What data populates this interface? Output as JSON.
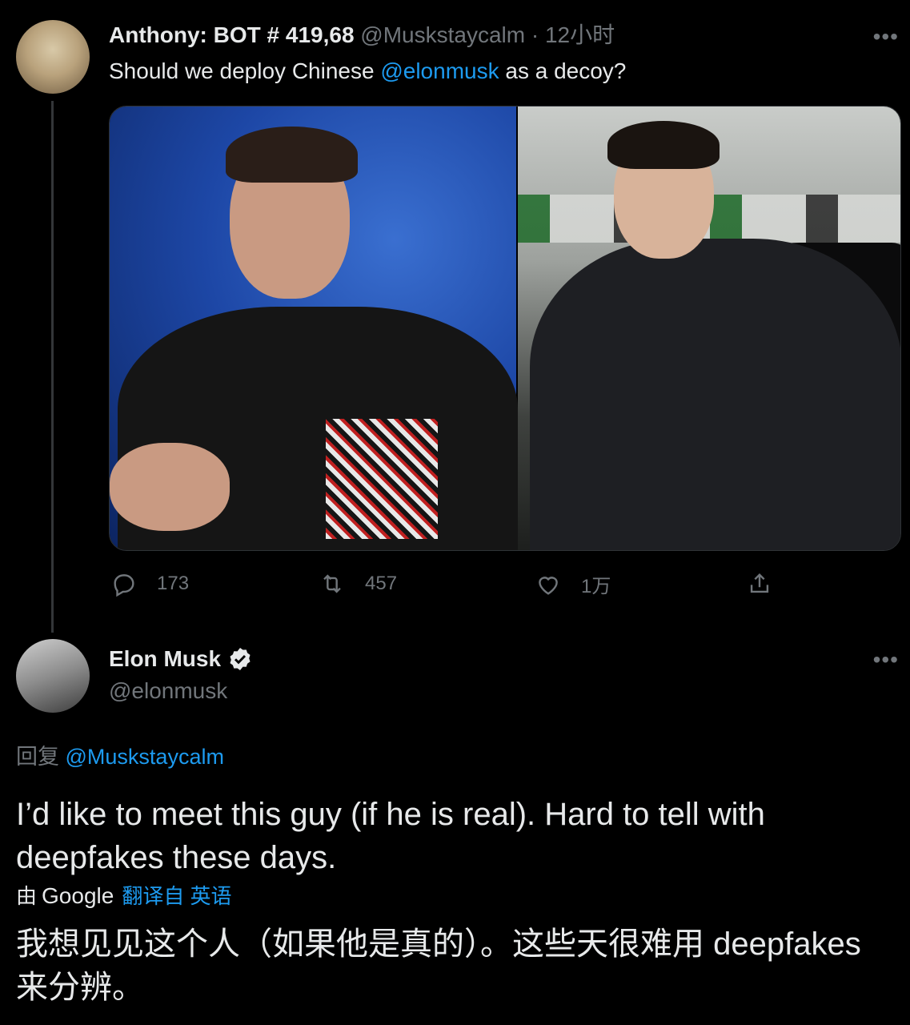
{
  "parent_tweet": {
    "display_name": "Anthony: BOT # 419,68",
    "handle": "@Muskstaycalm",
    "separator": "·",
    "time": "12小时",
    "text_before": "Should we deploy Chinese ",
    "mention": "@elonmusk",
    "text_after": " as a decoy?",
    "more_label": "•••",
    "replies": "173",
    "retweets": "457",
    "likes": "1万"
  },
  "reply_tweet": {
    "display_name": "Elon Musk",
    "handle": "@elonmusk",
    "more_label": "•••",
    "reply_prefix": "回复 ",
    "reply_mention": "@Muskstaycalm",
    "text": "I’d like to meet this guy (if he is real). Hard to tell with deepfakes these days.",
    "translated_by_prefix": "由",
    "translated_by_brand": "Google",
    "translated_from": "翻译自 英语",
    "translation": "我想见见这个人（如果他是真的）。这些天很难用 deepfakes 来分辨。"
  },
  "colors": {
    "background": "#000000",
    "text": "#e7e9ea",
    "secondary": "#71767b",
    "link": "#1d9bf0"
  },
  "icons": [
    "reply-icon",
    "retweet-icon",
    "like-icon",
    "share-icon",
    "verified-icon",
    "more-icon"
  ]
}
